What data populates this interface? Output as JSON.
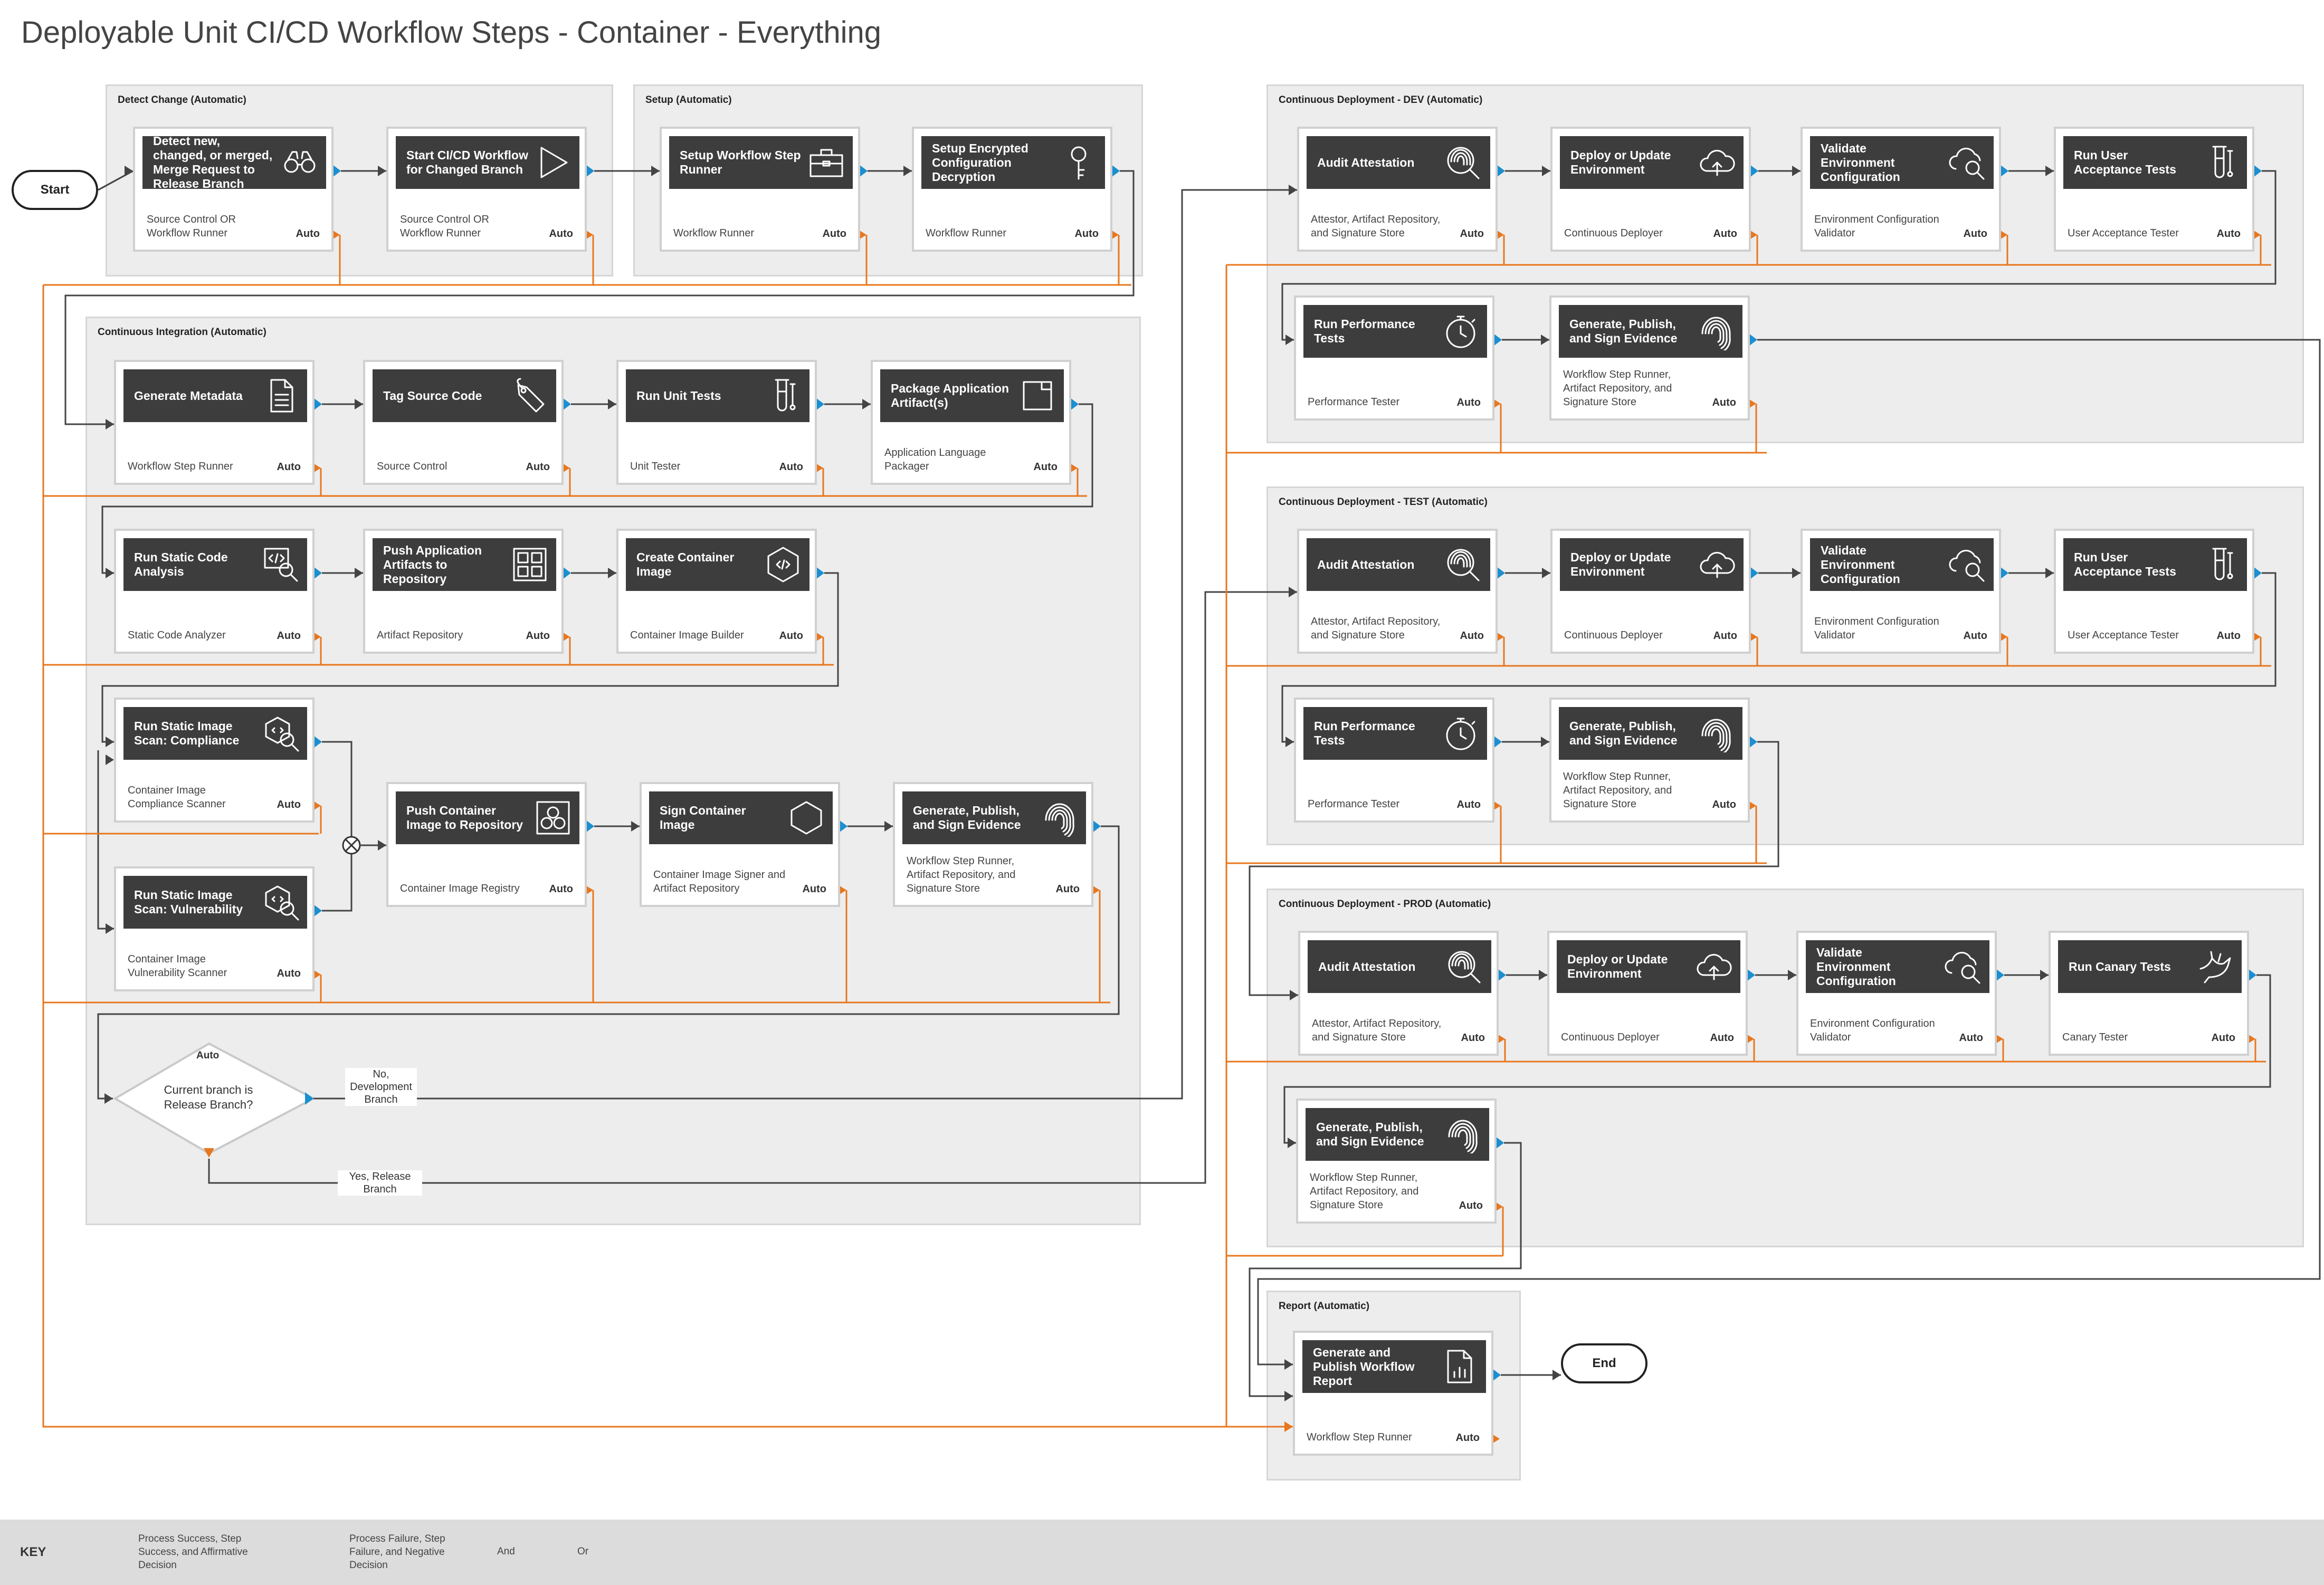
{
  "title": "Deployable Unit CI/CD Workflow Steps - Container - Everything",
  "colors": {
    "success": "#1a8fd1",
    "failure": "#e8771e",
    "panel": "#ededed",
    "head": "#3d3d3d"
  },
  "terminals": {
    "start": "Start",
    "end": "End"
  },
  "panels": {
    "detect": {
      "name": "Detect Change",
      "mode": "(Automatic)"
    },
    "setup": {
      "name": "Setup",
      "mode": "(Automatic)"
    },
    "ci": {
      "name": "Continuous Integration",
      "mode": "(Automatic)"
    },
    "dev": {
      "name": "Continuous Deployment - DEV",
      "mode": "(Automatic)"
    },
    "test": {
      "name": "Continuous Deployment - TEST",
      "mode": "(Automatic)"
    },
    "prod": {
      "name": "Continuous Deployment - PROD",
      "mode": "(Automatic)"
    },
    "report": {
      "name": "Report",
      "mode": "(Automatic)"
    }
  },
  "cards": {
    "c01": {
      "title": "Detect new, changed, or merged, Merge Request to Release Branch",
      "owner": "Source Control OR Workflow Runner",
      "auto": "Auto",
      "icon": "binoculars-icon"
    },
    "c02": {
      "title": "Start CI/CD Workflow for Changed Branch",
      "owner": "Source Control OR Workflow Runner",
      "auto": "Auto",
      "icon": "play-icon"
    },
    "c03": {
      "title": "Setup Workflow Step Runner",
      "owner": "Workflow Runner",
      "auto": "Auto",
      "icon": "toolbox-icon"
    },
    "c04": {
      "title": "Setup Encrypted Configuration Decryption",
      "owner": "Workflow Runner",
      "auto": "Auto",
      "icon": "key-icon"
    },
    "c05": {
      "title": "Generate Metadata",
      "owner": "Workflow Step Runner",
      "auto": "Auto",
      "icon": "document-icon"
    },
    "c06": {
      "title": "Tag Source Code",
      "owner": "Source Control",
      "auto": "Auto",
      "icon": "tag-icon"
    },
    "c07": {
      "title": "Run Unit Tests",
      "owner": "Unit Tester",
      "auto": "Auto",
      "icon": "test-tube-icon"
    },
    "c08": {
      "title": "Package Application Artifact(s)",
      "owner": "Application Language Packager",
      "auto": "Auto",
      "icon": "package-icon"
    },
    "c09": {
      "title": "Run Static Code Analysis",
      "owner": "Static Code Analyzer",
      "auto": "Auto",
      "icon": "code-magnifier-icon"
    },
    "c10": {
      "title": "Push Application Artifacts to Repository",
      "owner": "Artifact Repository",
      "auto": "Auto",
      "icon": "repository-icon"
    },
    "c11": {
      "title": "Create Container Image",
      "owner": "Container Image Builder",
      "auto": "Auto",
      "icon": "container-icon"
    },
    "c12": {
      "title": "Run Static Image Scan: Compliance",
      "owner": "Container Image Compliance Scanner",
      "auto": "Auto",
      "icon": "image-scan-icon"
    },
    "c13": {
      "title": "Run Static Image Scan: Vulnerability",
      "owner": "Container Image Vulnerability Scanner",
      "auto": "Auto",
      "icon": "image-scan-icon"
    },
    "c14": {
      "title": "Push Container Image to Repository",
      "owner": "Container Image Registry",
      "auto": "Auto",
      "icon": "registry-icon"
    },
    "c15": {
      "title": "Sign Container Image",
      "owner": "Container Image Signer and Artifact Repository",
      "auto": "Auto",
      "icon": "shield-icon"
    },
    "c16": {
      "title": "Generate, Publish, and Sign Evidence",
      "owner": "Workflow Step Runner, Artifact Repository, and Signature Store",
      "auto": "Auto",
      "icon": "fingerprint-icon"
    },
    "d01": {
      "title": "Audit Attestation",
      "owner": "Attestor, Artifact Repository, and Signature Store",
      "auto": "Auto",
      "icon": "fingerprint-magnifier-icon"
    },
    "d02": {
      "title": "Deploy or Update Environment",
      "owner": "Continuous Deployer",
      "auto": "Auto",
      "icon": "cloud-upload-icon"
    },
    "d03": {
      "title": "Validate Environment Configuration",
      "owner": "Environment Configuration Validator",
      "auto": "Auto",
      "icon": "cloud-magnifier-icon"
    },
    "d04": {
      "title": "Run User Acceptance Tests",
      "owner": "User Acceptance Tester",
      "auto": "Auto",
      "icon": "test-tube-icon"
    },
    "d05": {
      "title": "Run Performance Tests",
      "owner": "Performance Tester",
      "auto": "Auto",
      "icon": "stopwatch-icon"
    },
    "d06": {
      "title": "Generate, Publish, and Sign Evidence",
      "owner": "Workflow Step Runner, Artifact Repository, and Signature Store",
      "auto": "Auto",
      "icon": "fingerprint-icon"
    },
    "t01": {
      "title": "Audit Attestation",
      "owner": "Attestor, Artifact Repository, and Signature Store",
      "auto": "Auto",
      "icon": "fingerprint-magnifier-icon"
    },
    "t02": {
      "title": "Deploy or Update Environment",
      "owner": "Continuous Deployer",
      "auto": "Auto",
      "icon": "cloud-upload-icon"
    },
    "t03": {
      "title": "Validate Environment Configuration",
      "owner": "Environment Configuration Validator",
      "auto": "Auto",
      "icon": "cloud-magnifier-icon"
    },
    "t04": {
      "title": "Run User Acceptance Tests",
      "owner": "User Acceptance Tester",
      "auto": "Auto",
      "icon": "test-tube-icon"
    },
    "t05": {
      "title": "Run Performance Tests",
      "owner": "Performance Tester",
      "auto": "Auto",
      "icon": "stopwatch-icon"
    },
    "t06": {
      "title": "Generate, Publish, and Sign Evidence",
      "owner": "Workflow Step Runner, Artifact Repository, and Signature Store",
      "auto": "Auto",
      "icon": "fingerprint-icon"
    },
    "p01": {
      "title": "Audit Attestation",
      "owner": "Attestor, Artifact Repository, and Signature Store",
      "auto": "Auto",
      "icon": "fingerprint-magnifier-icon"
    },
    "p02": {
      "title": "Deploy or Update Environment",
      "owner": "Continuous Deployer",
      "auto": "Auto",
      "icon": "cloud-upload-icon"
    },
    "p03": {
      "title": "Validate Environment Configuration",
      "owner": "Environment Configuration Validator",
      "auto": "Auto",
      "icon": "cloud-magnifier-icon"
    },
    "p04": {
      "title": "Run Canary Tests",
      "owner": "Canary Tester",
      "auto": "Auto",
      "icon": "bird-icon"
    },
    "p05": {
      "title": "Generate, Publish, and Sign Evidence",
      "owner": "Workflow Step Runner, Artifact Repository, and Signature Store",
      "auto": "Auto",
      "icon": "fingerprint-icon"
    },
    "r01": {
      "title": "Generate and Publish Workflow Report",
      "owner": "Workflow Step Runner",
      "auto": "Auto",
      "icon": "report-icon"
    }
  },
  "decision": {
    "question": "Current branch is Release Branch?",
    "auto": "Auto",
    "no_label": "No, Development Branch",
    "yes_label": "Yes, Release Branch"
  },
  "key": {
    "label": "KEY",
    "success": "Process Success, Step Success, and Affirmative Decision",
    "failure": "Process Failure, Step Failure, and Negative Decision",
    "and": "And",
    "or": "Or"
  }
}
